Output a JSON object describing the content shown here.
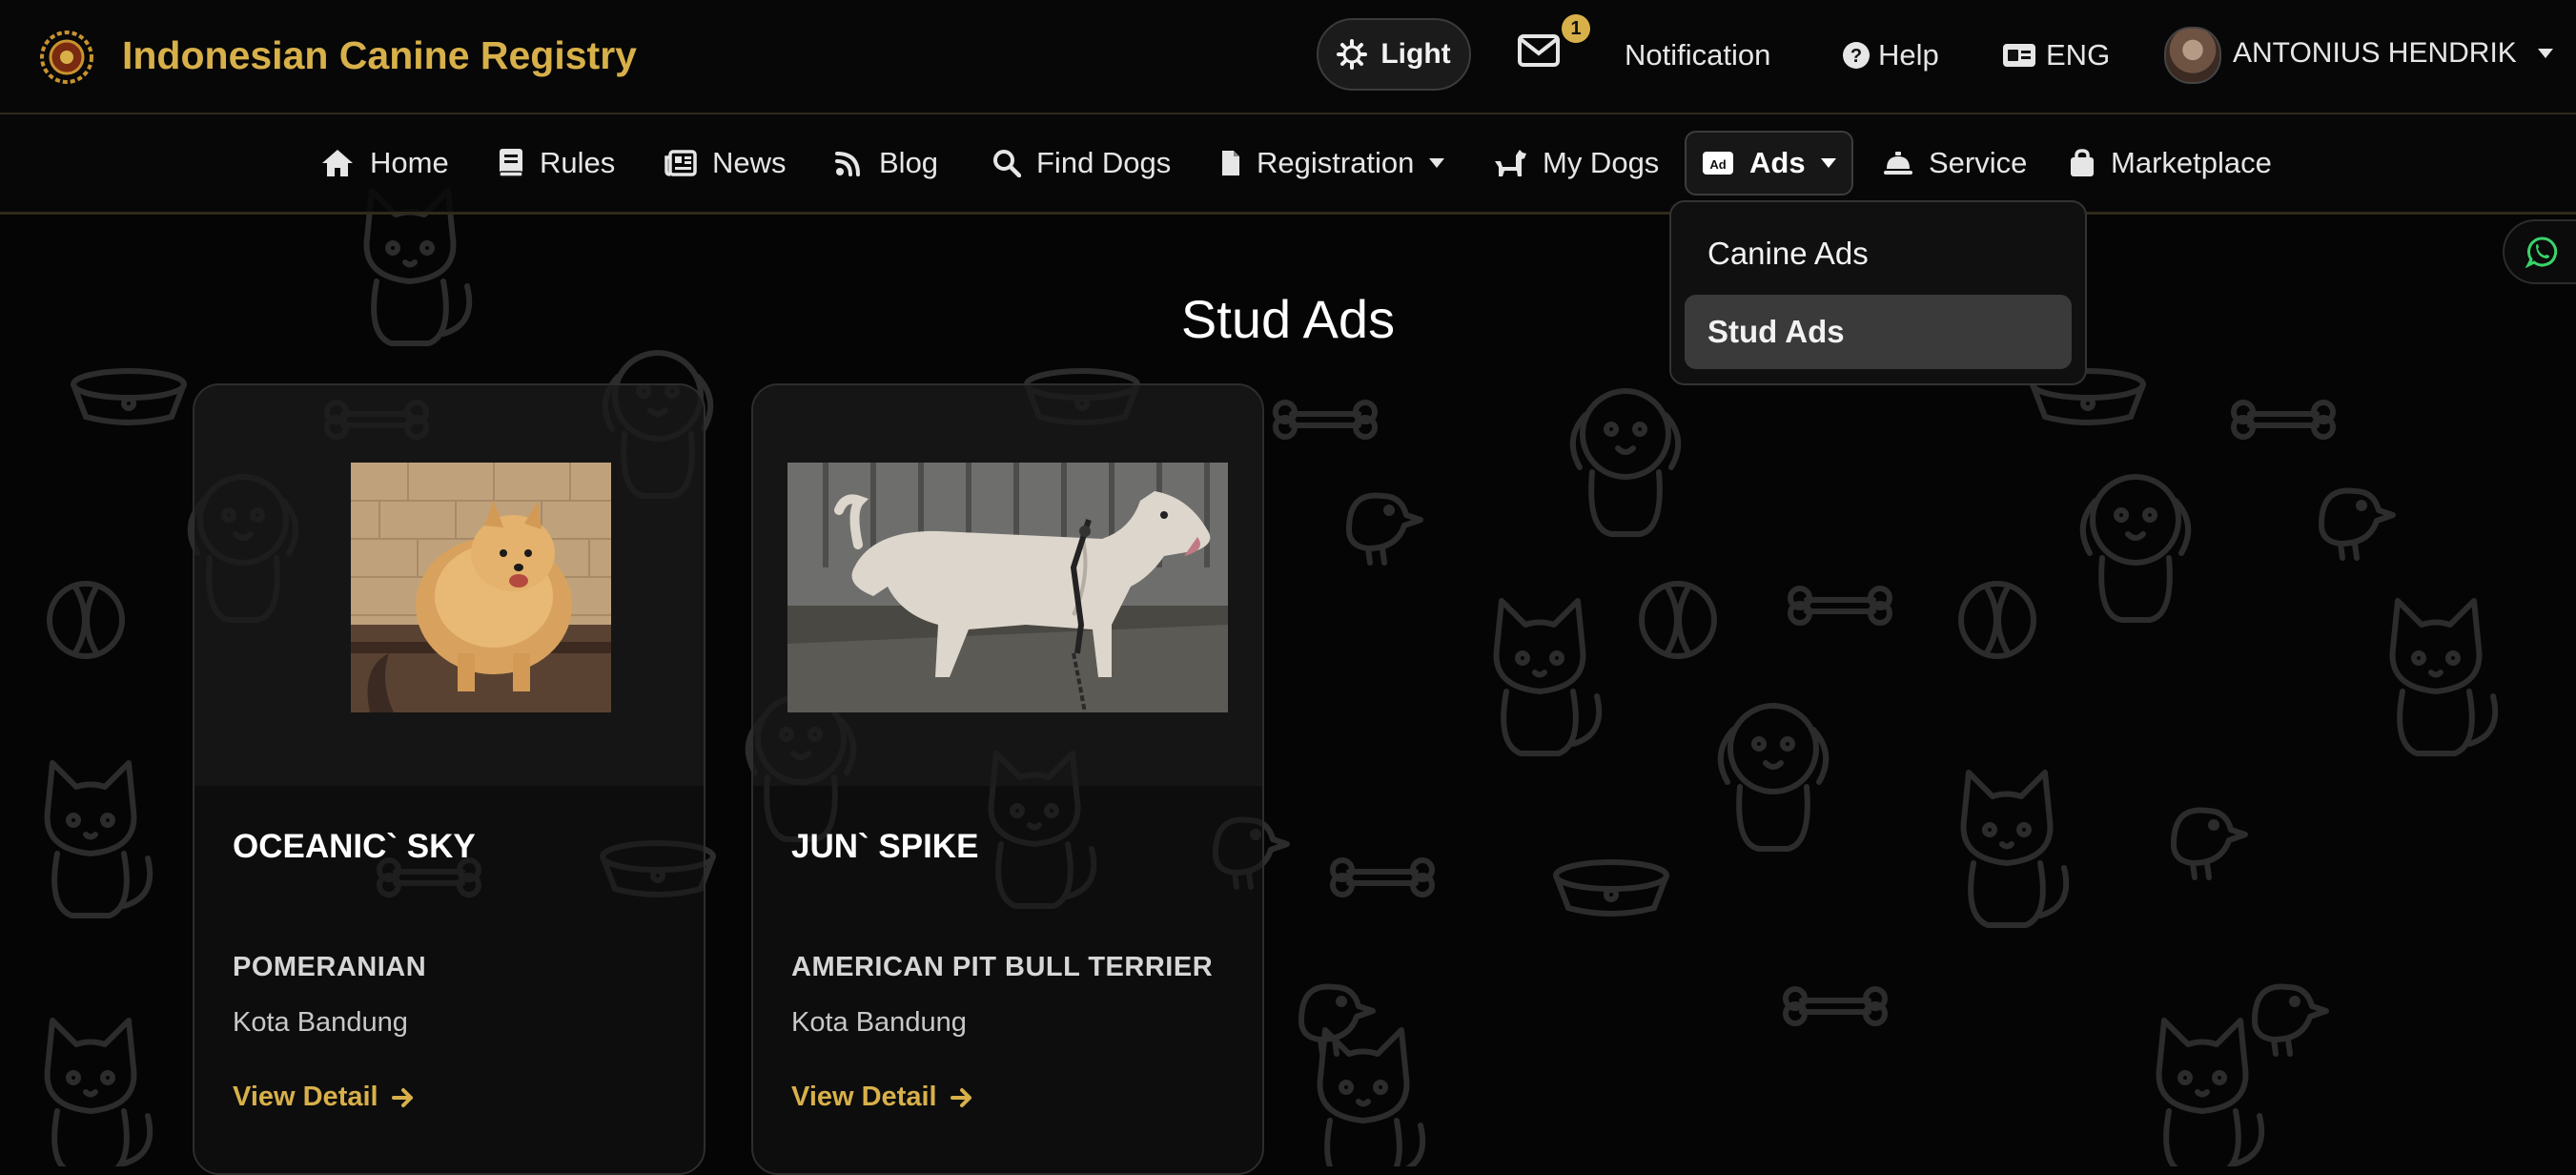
{
  "colors": {
    "accent": "#d8b04a",
    "background": "#050505"
  },
  "header": {
    "brand_title": "Indonesian Canine Registry",
    "theme_label": "Light",
    "mail_badge_count": "1",
    "notification_label": "Notification",
    "help_label": "Help",
    "language_label": "ENG",
    "user_name": "ANTONIUS HENDRIK"
  },
  "nav": {
    "items": [
      {
        "label": "Home",
        "icon": "home-icon"
      },
      {
        "label": "Rules",
        "icon": "book-icon"
      },
      {
        "label": "News",
        "icon": "newspaper-icon"
      },
      {
        "label": "Blog",
        "icon": "blog-icon"
      },
      {
        "label": "Find Dogs",
        "icon": "search-icon"
      },
      {
        "label": "Registration",
        "icon": "file-icon"
      },
      {
        "label": "My Dogs",
        "icon": "dog-icon"
      },
      {
        "label": "Ads",
        "icon": "ad-icon"
      },
      {
        "label": "Service",
        "icon": "bell-service-icon"
      },
      {
        "label": "Marketplace",
        "icon": "shopping-bag-icon"
      }
    ],
    "ads_dropdown": {
      "items": [
        {
          "label": "Canine Ads"
        },
        {
          "label": "Stud Ads"
        }
      ],
      "selected": "Stud Ads"
    }
  },
  "main": {
    "title": "Stud Ads",
    "cards": [
      {
        "name": "OCEANIC` SKY",
        "breed": "POMERANIAN",
        "city": "Kota Bandung",
        "link_label": "View Detail"
      },
      {
        "name": "JUN` SPIKE",
        "breed": "AMERICAN PIT BULL TERRIER",
        "city": "Kota Bandung",
        "link_label": "View Detail"
      }
    ]
  }
}
